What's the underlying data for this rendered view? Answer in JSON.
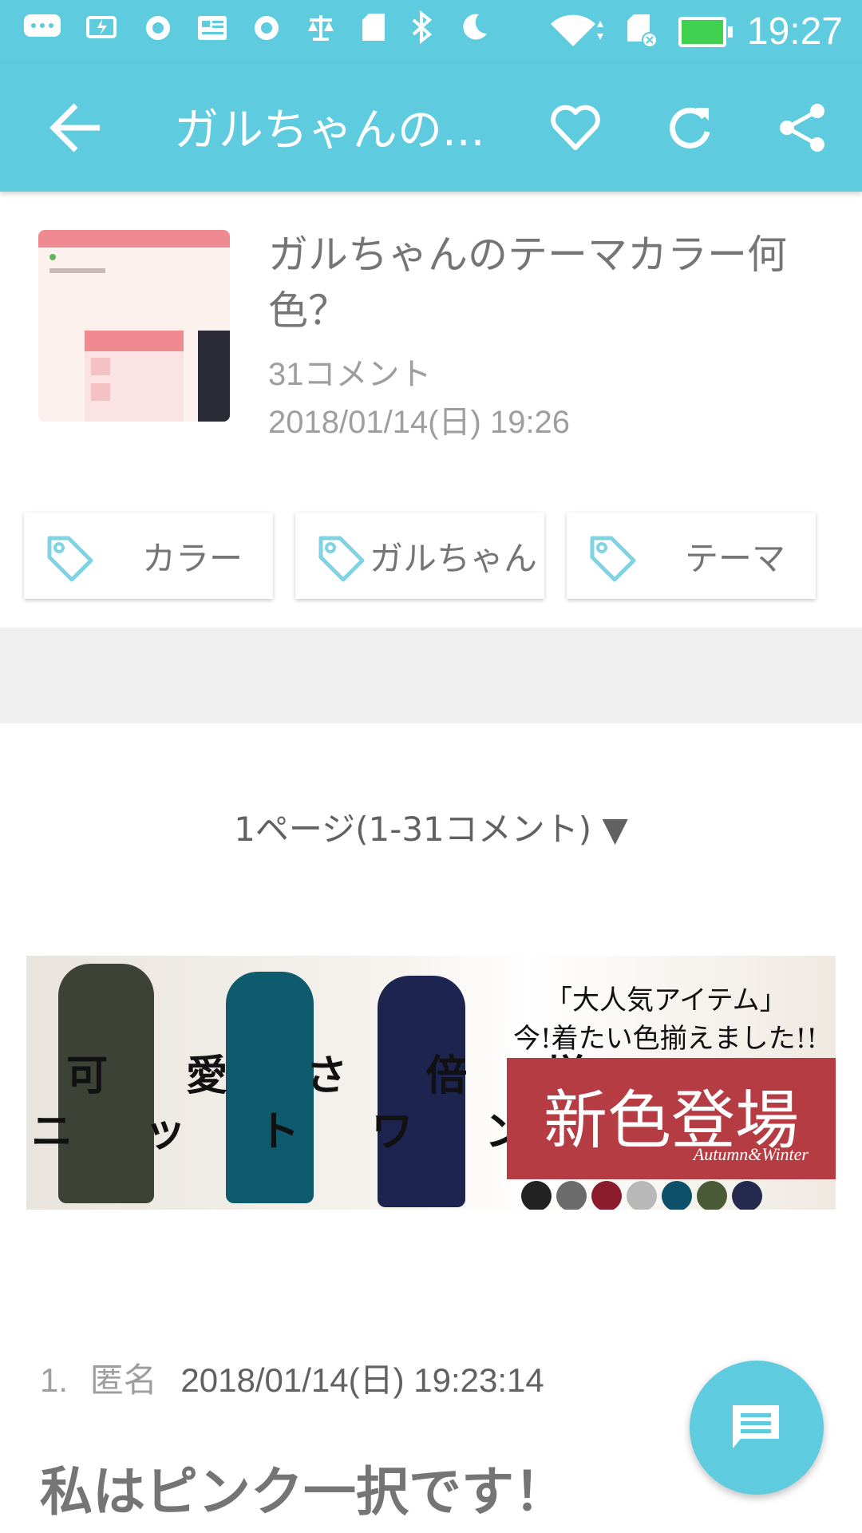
{
  "status_bar": {
    "time": "19:27",
    "icons": [
      "chat-bubble-icon",
      "battery-saver-icon",
      "record-icon",
      "list-icon",
      "record-icon",
      "scale-icon",
      "sd-card-icon",
      "bluetooth-icon",
      "moon-icon",
      "wifi-icon",
      "sd-card-error-icon",
      "battery-charging-icon"
    ]
  },
  "app_bar": {
    "title": "ガルちゃんの...",
    "actions": [
      "back-arrow-icon",
      "heart-icon",
      "refresh-icon",
      "share-icon"
    ]
  },
  "post": {
    "title": "ガルちゃんのテーマカラー何色？",
    "comments": "31コメント",
    "date": "2018/01/14(日) 19:26"
  },
  "tags": [
    {
      "label": "カラー"
    },
    {
      "label": "ガルちゃん"
    },
    {
      "label": "テーマ"
    }
  ],
  "pager": {
    "label": "1ページ(1-31コメント) ▼"
  },
  "banner": {
    "left_line1": "可 愛 さ 倍 増",
    "left_line2": "ニ ッ ト ワ ン ピ",
    "quote": "「大人気アイテム」",
    "sub": "今!着たい色揃えました!!",
    "headline": "新色登場",
    "season": "Autumn&Winter",
    "swatches": [
      "#222222",
      "#6b6b6b",
      "#8a1c2c",
      "#b8b8b8",
      "#0e4f6a",
      "#4a5a36",
      "#232a4e"
    ]
  },
  "comment": {
    "number": "1.",
    "author": "匿名",
    "date": "2018/01/14(日) 19:23:14",
    "text": "私はピンク一択です！"
  },
  "colors": {
    "accent": "#5ecbde",
    "text": "#757575"
  }
}
